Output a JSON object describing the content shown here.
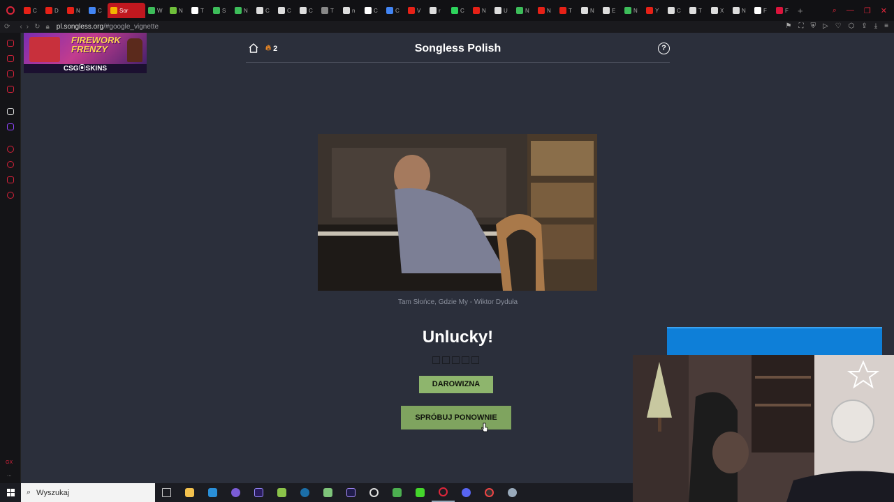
{
  "browser": {
    "url_host": "pl.songless.org",
    "url_path": "/#google_vignette",
    "active_tab_label": "Sor",
    "tabs": [
      {
        "label": "C",
        "color": "#e62117"
      },
      {
        "label": "D",
        "color": "#e62117"
      },
      {
        "label": "N",
        "color": "#e62117"
      },
      {
        "label": "C",
        "color": "#4285f4"
      },
      {
        "label": "Sor",
        "color": "#f4b400",
        "active": true
      },
      {
        "label": "W",
        "color": "#3dbd5a"
      },
      {
        "label": "N",
        "color": "#6fbf3a"
      },
      {
        "label": "T",
        "color": "#ffffff"
      },
      {
        "label": "S",
        "color": "#3dbd5a"
      },
      {
        "label": "N",
        "color": "#3dbd5a"
      },
      {
        "label": "C",
        "color": "#dddddd"
      },
      {
        "label": "C",
        "color": "#dddddd"
      },
      {
        "label": "C",
        "color": "#dddddd"
      },
      {
        "label": "T",
        "color": "#888888"
      },
      {
        "label": "n",
        "color": "#dddddd"
      },
      {
        "label": "C",
        "color": "#ffffff"
      },
      {
        "label": "C",
        "color": "#4285f4"
      },
      {
        "label": "V",
        "color": "#e62117"
      },
      {
        "label": "r",
        "color": "#dddddd"
      },
      {
        "label": "C",
        "color": "#2dd35c"
      },
      {
        "label": "N",
        "color": "#e62117"
      },
      {
        "label": "U",
        "color": "#dddddd"
      },
      {
        "label": "N",
        "color": "#3dbd5a"
      },
      {
        "label": "N",
        "color": "#e62117"
      },
      {
        "label": "T",
        "color": "#e62117"
      },
      {
        "label": "N",
        "color": "#dddddd"
      },
      {
        "label": "E",
        "color": "#dddddd"
      },
      {
        "label": "N",
        "color": "#3dbd5a"
      },
      {
        "label": "Y",
        "color": "#e62117"
      },
      {
        "label": "C",
        "color": "#dddddd"
      },
      {
        "label": "T",
        "color": "#dddddd"
      },
      {
        "label": "X",
        "color": "#dddddd"
      },
      {
        "label": "N",
        "color": "#dddddd"
      },
      {
        "label": "F",
        "color": "#ffffff"
      },
      {
        "label": "F",
        "color": "#dc143c"
      }
    ],
    "sidebar_gx_label": "GX",
    "sidebar_more_label": "..."
  },
  "ad": {
    "title_line": "FIREWORK FRENZY",
    "brand": "CSG⦿SKINS"
  },
  "header": {
    "streak_count": "2",
    "title": "Songless Polish"
  },
  "song": {
    "caption": "Tam Słońce, Gdzie My - Wiktor Dyduła"
  },
  "result": {
    "title": "Unlucky!",
    "attempts_total": 5
  },
  "buttons": {
    "donate": "DAROWIZNA",
    "retry": "SPRÓBUJ PONOWNIE"
  },
  "taskbar": {
    "search_placeholder": "Wyszukaj"
  },
  "colors": {
    "page_bg": "#2b2f3b",
    "button_green": "#8eb56d",
    "opera_red": "#e0263b",
    "overlay_blue": "#0e7fd8"
  }
}
